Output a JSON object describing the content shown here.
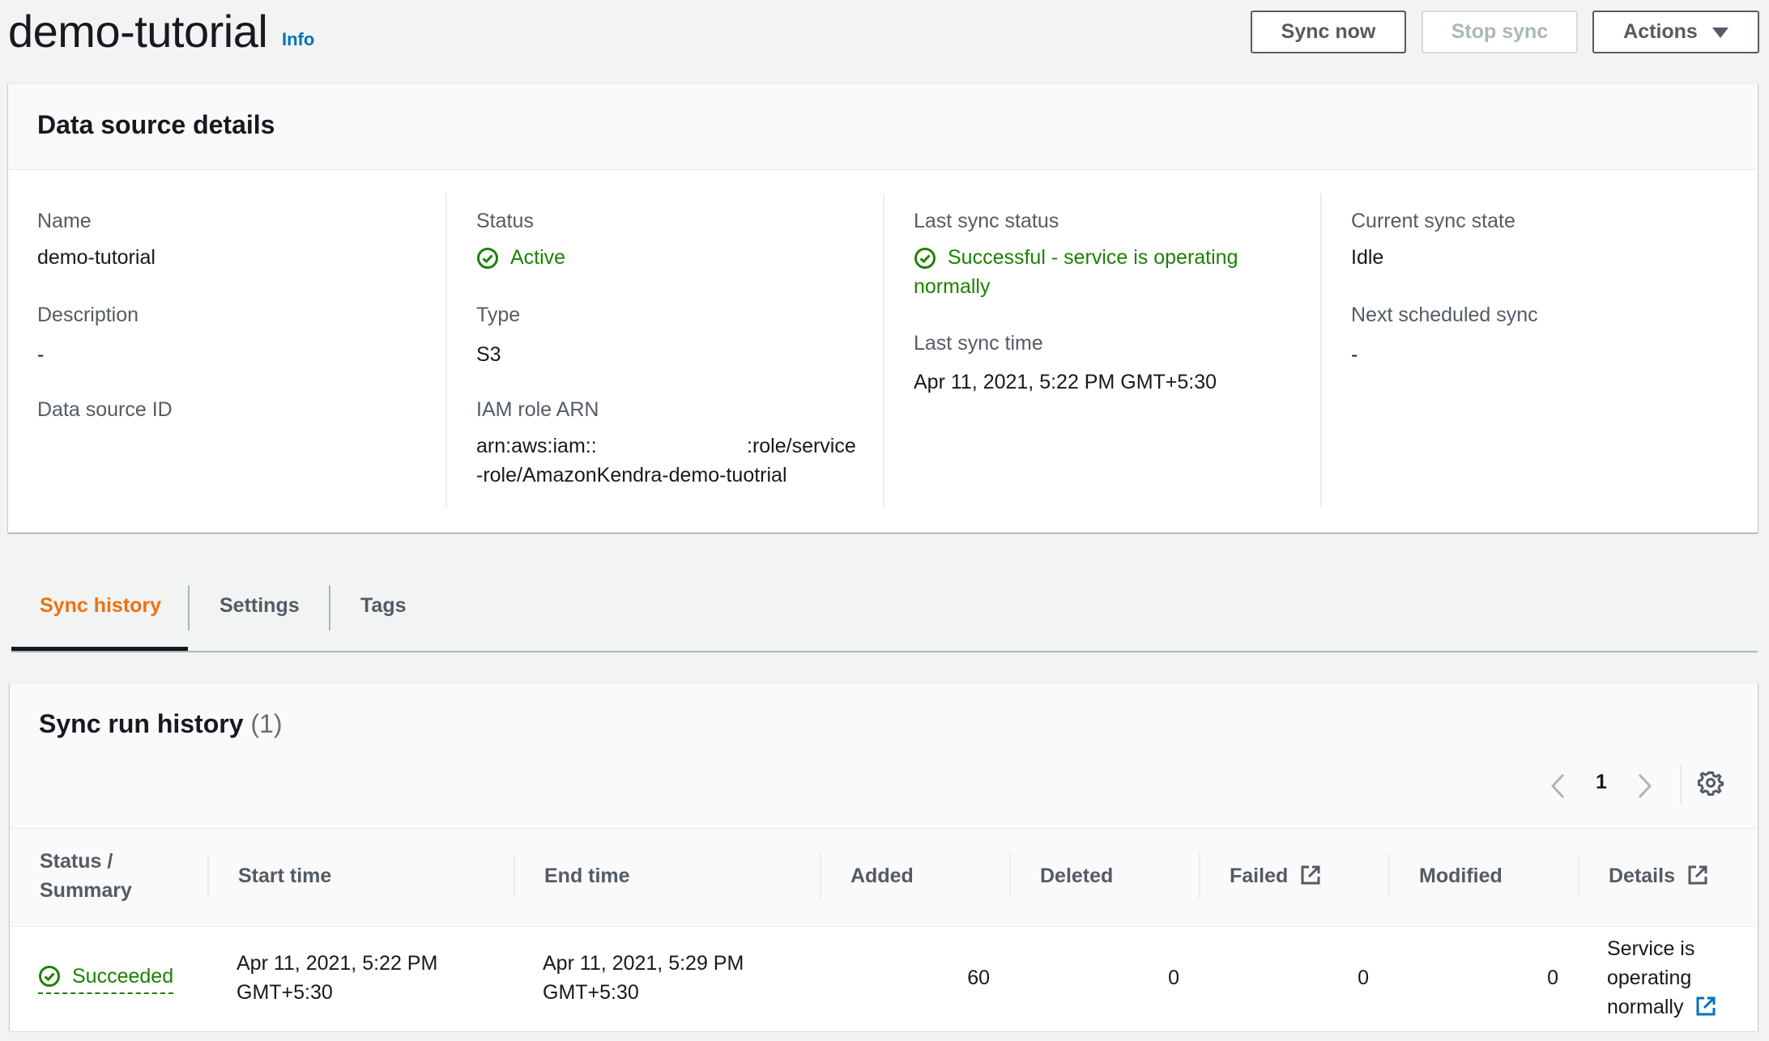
{
  "header": {
    "title": "demo-tutorial",
    "info_link": "Info",
    "sync_now": "Sync now",
    "stop_sync": "Stop sync",
    "actions": "Actions"
  },
  "details": {
    "heading": "Data source details",
    "name_label": "Name",
    "name_value": "demo-tutorial",
    "description_label": "Description",
    "description_value": "-",
    "data_source_id_label": "Data source ID",
    "status_label": "Status",
    "status_value": "Active",
    "type_label": "Type",
    "type_value": "S3",
    "iam_role_label": "IAM role ARN",
    "iam_role_line1a": "arn:aws:iam::",
    "iam_role_line1b": ":role/service",
    "iam_role_line2": "-role/AmazonKendra-demo-tuotrial",
    "last_sync_status_label": "Last sync status",
    "last_sync_status_value_line1": "Successful - service is operating",
    "last_sync_status_value_line2": "normally",
    "last_sync_time_label": "Last sync time",
    "last_sync_time_value": "Apr 11, 2021, 5:22 PM GMT+5:30",
    "current_sync_state_label": "Current sync state",
    "current_sync_state_value": "Idle",
    "next_scheduled_sync_label": "Next scheduled sync",
    "next_scheduled_sync_value": "-"
  },
  "tabs": [
    "Sync history",
    "Settings",
    "Tags"
  ],
  "history": {
    "title": "Sync run history",
    "count": "(1)",
    "page": "1",
    "columns": {
      "status_line1": "Status /",
      "status_line2": "Summary",
      "start_time": "Start time",
      "end_time": "End time",
      "added": "Added",
      "deleted": "Deleted",
      "failed": "Failed",
      "modified": "Modified",
      "details": "Details"
    },
    "rows": [
      {
        "status": "Succeeded",
        "start_line1": "Apr 11, 2021, 5:22 PM",
        "start_line2": "GMT+5:30",
        "end_line1": "Apr 11, 2021, 5:29 PM",
        "end_line2": "GMT+5:30",
        "added": "60",
        "deleted": "0",
        "failed": "0",
        "modified": "0",
        "details_line1": "Service is",
        "details_line2": "operating",
        "details_line3": "normally"
      }
    ]
  },
  "colors": {
    "success": "#1d8102",
    "tab_active": "#ec7211",
    "link": "#0073bb"
  }
}
